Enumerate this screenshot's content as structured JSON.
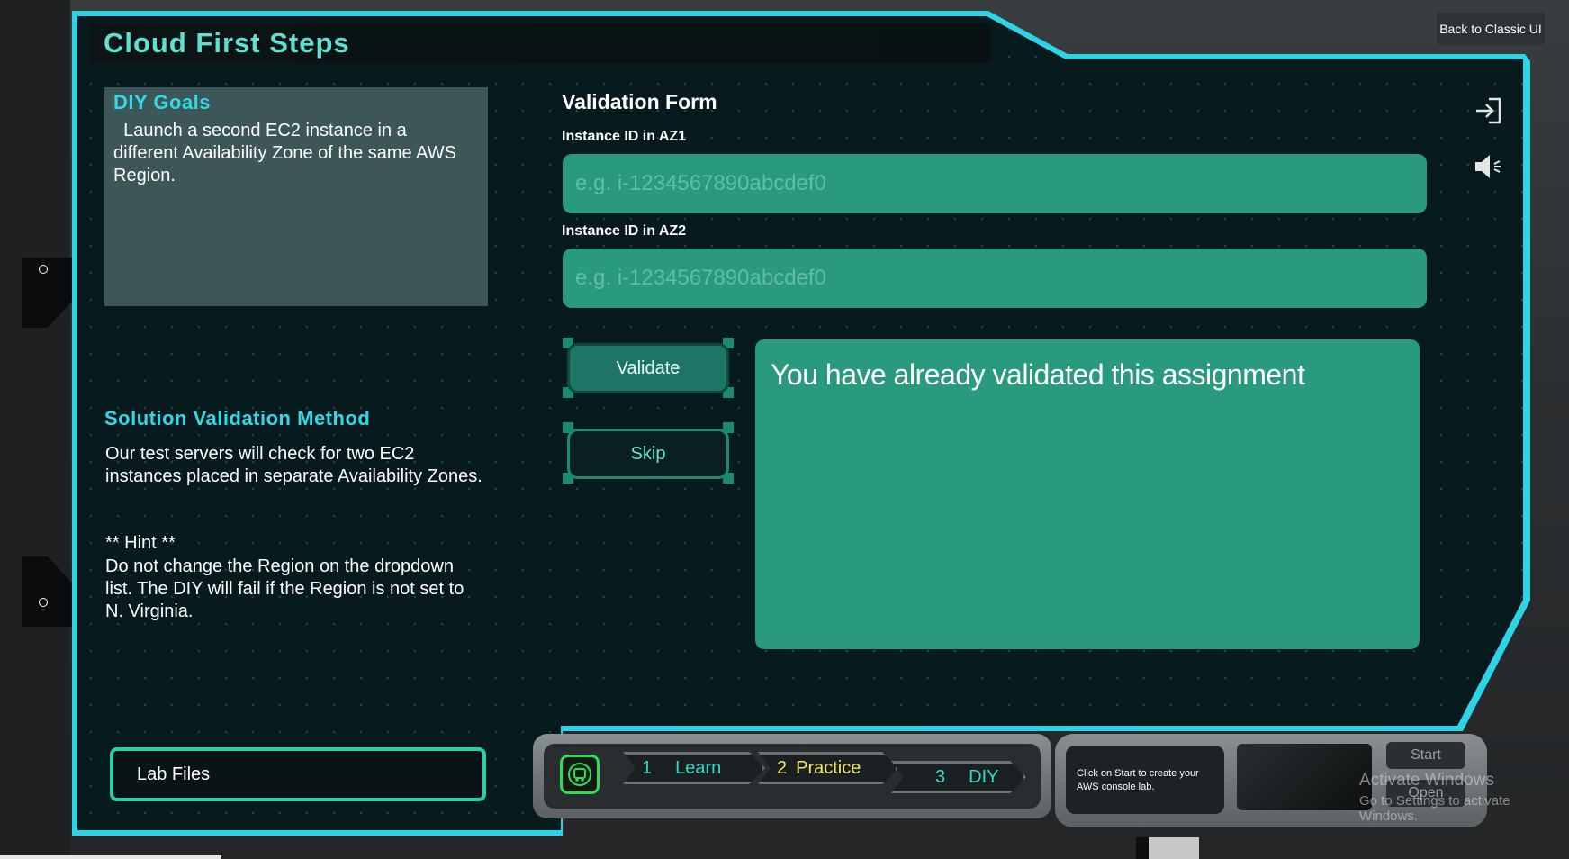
{
  "header": {
    "title": "Cloud First Steps",
    "classic_ui_label": "Back to Classic UI"
  },
  "diy_goals": {
    "heading": "DIY Goals",
    "text": "Launch a second EC2 instance in a different Availability Zone of the same AWS Region."
  },
  "solution_validation": {
    "heading": "Solution Validation Method",
    "text": "Our test servers will check for two EC2 instances placed in separate Availability Zones.",
    "hint_heading": "** Hint **",
    "hint_text": "Do not change the Region on the dropdown list. The DIY will fail if the Region is not set to N. Virginia."
  },
  "validation_form": {
    "title": "Validation Form",
    "az1_label": "Instance ID in AZ1",
    "az1_placeholder": "e.g. i-1234567890abcdef0",
    "az1_value": "",
    "az2_label": "Instance ID in AZ2",
    "az2_placeholder": "e.g. i-1234567890abcdef0",
    "az2_value": "",
    "validate_label": "Validate",
    "skip_label": "Skip",
    "message": "You have already validated this assignment"
  },
  "lab_files_label": "Lab Files",
  "steps": [
    {
      "num": "1",
      "label": "Learn"
    },
    {
      "num": "2",
      "label": "Practice"
    },
    {
      "num": "3",
      "label": "DIY"
    }
  ],
  "lab_info": "Click on Start to create your AWS console lab.",
  "start_label": "Start",
  "open_label": "Open",
  "watermark": {
    "line1": "Activate Windows",
    "line2": "Go to Settings to activate Windows."
  },
  "colors": {
    "accent_cyan": "#33d8e6",
    "form_teal": "#2a9a7f",
    "step_yellow": "#f4e66a",
    "step_teal": "#33d8c8"
  },
  "icons": [
    "exit-icon",
    "speaker-icon",
    "robot-icon"
  ]
}
